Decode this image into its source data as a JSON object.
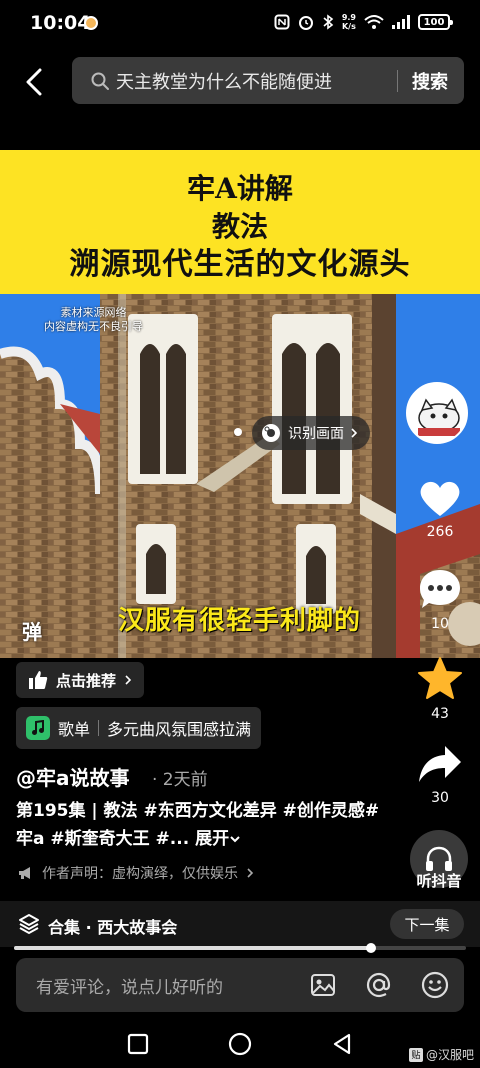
{
  "status_bar": {
    "time": "10:04",
    "net_speed_value": "9.9",
    "net_speed_unit": "K/s",
    "battery": "100",
    "icons": [
      "nfc-icon",
      "alarm-icon",
      "bluetooth-icon",
      "vibrate-icon",
      "wifi-icon",
      "signal-icon",
      "battery-icon"
    ]
  },
  "search": {
    "query": "天主教堂为什么不能随便进",
    "button_label": "搜索"
  },
  "video": {
    "banner_lines": [
      "牢A讲解",
      "教法",
      "溯源现代生活的文化源头"
    ],
    "disclaimer_lines": [
      "素材来源网络",
      "内容虚构无不良引导"
    ],
    "identify_label": "识别画面",
    "subtitle": "汉服有很轻手利脚的",
    "danmaku_label": "弹"
  },
  "rail": {
    "likes": "266",
    "comments": "10",
    "favorites": "43",
    "shares": "30",
    "listen_label": "听抖音"
  },
  "info": {
    "recommend_label": "点击推荐",
    "music_tag": "歌单",
    "music_title": "多元曲风氛围感拉满",
    "author": "@牢a说故事",
    "time_ago": "· 2天前",
    "description": "第195集 | 教法 #东西方文化差异 #创作灵感#牢a #斯奎奇大王 #... ",
    "expand_label": "展开",
    "statement": "作者声明：虚构演绎，仅供娱乐"
  },
  "collection": {
    "label": "合集 · 西大故事会",
    "next_label": "下一集",
    "progress": 0.79
  },
  "comment": {
    "placeholder": "有爱评论，说点儿好听的"
  },
  "watermark": {
    "text": "@汉服吧",
    "logo": "贴"
  },
  "colors": {
    "banner": "#fde323",
    "subtitle": "#fbe81a",
    "star": "#ffb62b",
    "sky": "#2f7fe8",
    "brick": "#8a6a47"
  }
}
